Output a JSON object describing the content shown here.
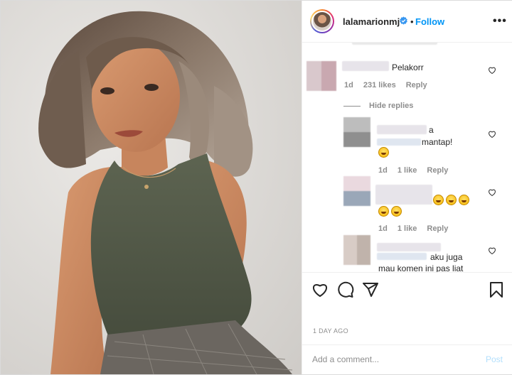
{
  "post": {
    "username": "lalamarionmj",
    "follow_label": "Follow",
    "separator": "•",
    "more_label": "•••"
  },
  "comments": [
    {
      "text_suffix": "Pelakorr",
      "age": "1d",
      "likes": "231 likes",
      "reply_label": "Reply"
    }
  ],
  "hide_replies_label": "Hide replies",
  "replies": [
    {
      "text_part1": "a",
      "text_part2": "mantap!",
      "age": "1d",
      "likes": "1 like",
      "reply_label": "Reply"
    },
    {
      "age": "1d",
      "likes": "1 like",
      "reply_label": "Reply"
    },
    {
      "text_part1": "aku juga",
      "text_part2": "mau komen ini pas liat"
    }
  ],
  "timestamp": "1 DAY AGO",
  "add_comment": {
    "placeholder": "Add a comment...",
    "post_label": "Post"
  },
  "icons": {
    "like": "heart-icon",
    "comment": "comment-icon",
    "share": "share-icon",
    "save": "bookmark-icon",
    "verified": "verified-badge-icon"
  },
  "colors": {
    "accent": "#0095f6",
    "muted": "#8e8e8e",
    "post_disabled": "#b2dffc"
  }
}
